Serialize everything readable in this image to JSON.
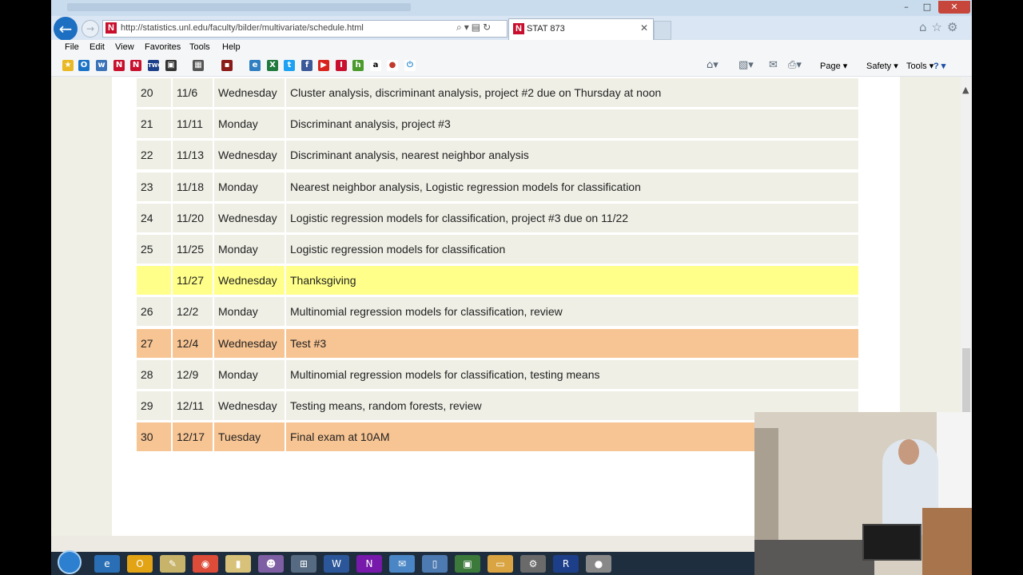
{
  "browser": {
    "url": "http://statistics.unl.edu/faculty/bilder/multivariate/schedule.html",
    "tab_title": "STAT 873",
    "tab_logo": "N",
    "window_controls": {
      "minimize": "–",
      "maximize": "□",
      "close": "✕"
    }
  },
  "menu": [
    "File",
    "Edit",
    "View",
    "Favorites",
    "Tools",
    "Help"
  ],
  "command_bar": {
    "page": "Page ▾",
    "safety": "Safety ▾",
    "tools": "Tools ▾",
    "help": "? ▾"
  },
  "favorites_icons": [
    "favorites-star",
    "outlook",
    "web-slice",
    "unl-n",
    "unl-n",
    "twc-weather",
    "movie",
    "photos",
    "tv-guide",
    "ie",
    "excel",
    "twitter",
    "facebook",
    "youtube",
    "unl-i",
    "h-icon",
    "amazon",
    "pin",
    "power"
  ],
  "schedule": [
    {
      "num": "20",
      "date": "11/6",
      "day": "Wednesday",
      "desc": "Cluster analysis, discriminant analysis, project #2 due on Thursday at noon",
      "type": "normal"
    },
    {
      "num": "21",
      "date": "11/11",
      "day": "Monday",
      "desc": "Discriminant analysis, project #3",
      "type": "normal"
    },
    {
      "num": "22",
      "date": "11/13",
      "day": "Wednesday",
      "desc": "Discriminant analysis, nearest neighbor analysis",
      "type": "normal"
    },
    {
      "num": "23",
      "date": "11/18",
      "day": "Monday",
      "desc": "Nearest neighbor analysis, Logistic regression models for classification",
      "type": "normal"
    },
    {
      "num": "24",
      "date": "11/20",
      "day": "Wednesday",
      "desc": "Logistic regression models for classification, project #3 due on 11/22",
      "type": "normal"
    },
    {
      "num": "25",
      "date": "11/25",
      "day": "Monday",
      "desc": "Logistic regression models for classification",
      "type": "normal"
    },
    {
      "num": "",
      "date": "11/27",
      "day": "Wednesday",
      "desc": "Thanksgiving",
      "type": "holiday"
    },
    {
      "num": "26",
      "date": "12/2",
      "day": "Monday",
      "desc": "Multinomial regression models for classification, review",
      "type": "normal"
    },
    {
      "num": "27",
      "date": "12/4",
      "day": "Wednesday",
      "desc": "Test #3",
      "type": "exam"
    },
    {
      "num": "28",
      "date": "12/9",
      "day": "Monday",
      "desc": "Multinomial regression models for classification, testing means",
      "type": "normal"
    },
    {
      "num": "29",
      "date": "12/11",
      "day": "Wednesday",
      "desc": "Testing means, random forests, review",
      "type": "normal"
    },
    {
      "num": "30",
      "date": "12/17",
      "day": "Tuesday",
      "desc": "Final exam at 10AM",
      "type": "exam"
    }
  ],
  "colors": {
    "normal_row": "#efefe6",
    "holiday_row": "#ffff8a",
    "exam_row": "#f7c493",
    "unl_red": "#c8102e"
  },
  "taskbar_apps": [
    "ie-icon",
    "outlook-icon",
    "notepad-icon",
    "chrome-icon",
    "folder-notes-icon",
    "paint-icon",
    "network-icon",
    "word-icon",
    "onenote-icon",
    "app-icon",
    "sas-icon",
    "projector-icon",
    "explorer-icon",
    "settings-icon",
    "r-icon",
    "record-icon"
  ]
}
